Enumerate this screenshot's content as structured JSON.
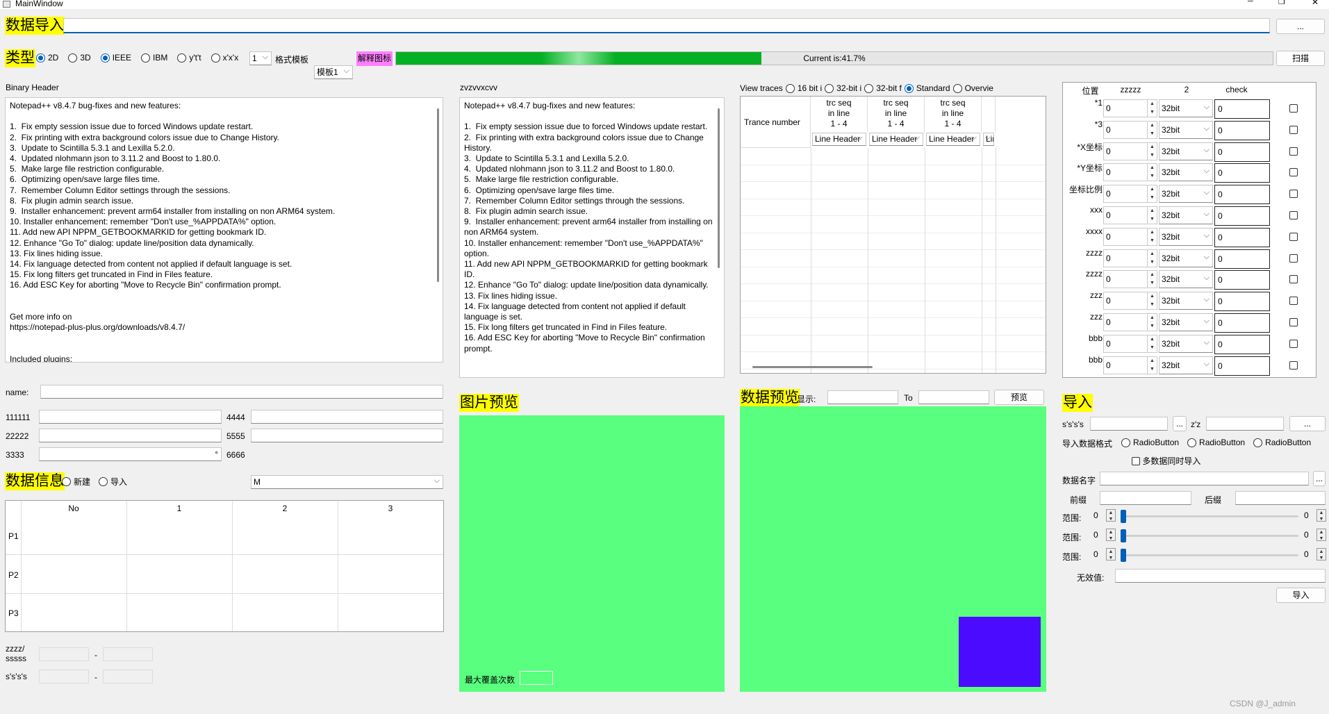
{
  "window": {
    "title": "MainWindow",
    "minimize": "─",
    "maximize": "❐",
    "close": "✕"
  },
  "import_bar": {
    "label": "数据导入",
    "path_value": "",
    "browse_label": "..."
  },
  "type_bar": {
    "label": "类型",
    "radios": [
      {
        "label": "2D",
        "checked": true
      },
      {
        "label": "3D",
        "checked": false
      },
      {
        "label": "IEEE",
        "checked": true
      },
      {
        "label": "IBM",
        "checked": false
      },
      {
        "label": "y't't",
        "checked": false
      },
      {
        "label": "x'x'x",
        "checked": false
      }
    ],
    "count_combo": "1",
    "template_label": "格式模板",
    "template_combo": "模板1",
    "explain_button": "解释图标",
    "progress_text": "Current is:41.7%",
    "progress": 0.417,
    "scan_button": "扫描",
    "colors": {
      "progress": "#06b025",
      "explain_bg": "#ff80ff"
    }
  },
  "binary_header": {
    "title": "Binary Header",
    "text": "Notepad++ v8.4.7 bug-fixes and new features:\n\n1.  Fix empty session issue due to forced Windows update restart.\n2.  Fix printing with extra background colors issue due to Change History.\n3.  Update to Scintilla 5.3.1 and Lexilla 5.2.0.\n4.  Updated nlohmann json to 3.11.2 and Boost to 1.80.0.\n5.  Make large file restriction configurable.\n6.  Optimizing open/save large files time.\n7.  Remember Column Editor settings through the sessions.\n8.  Fix plugin admin search issue.\n9.  Installer enhancement: prevent arm64 installer from installing on non ARM64 system.\n10. Installer enhancement: remember \"Don't use_%APPDATA%\" option.\n11. Add new API NPPM_GETBOOKMARKID for getting bookmark ID.\n12. Enhance \"Go To\" dialog: update line/position data dynamically.\n13. Fix lines hiding issue.\n14. Fix language detected from content not applied if default language is set.\n15. Fix long filters get truncated in Find in Files feature.\n16. Add ESC Key for aborting \"Move to Recycle Bin\" confirmation prompt.\n\n\nGet more info on\nhttps://notepad-plus-plus.org/downloads/v8.4.7/\n\n\nIncluded plugins:"
  },
  "second_panel": {
    "title": "zvzvvxcvv",
    "text": "Notepad++ v8.4.7 bug-fixes and new features:\n\n1.  Fix empty session issue due to forced Windows update restart.\n2.  Fix printing with extra background colors issue due to Change History.\n3.  Update to Scintilla 5.3.1 and Lexilla 5.2.0.\n4.  Updated nlohmann json to 3.11.2 and Boost to 1.80.0.\n5.  Make large file restriction configurable.\n6.  Optimizing open/save large files time.\n7.  Remember Column Editor settings through the sessions.\n8.  Fix plugin admin search issue.\n9.  Installer enhancement: prevent arm64 installer from installing on non ARM64 system.\n10. Installer enhancement: remember \"Don't use_%APPDATA%\" option.\n11. Add new API NPPM_GETBOOKMARKID for getting bookmark ID.\n12. Enhance \"Go To\" dialog: update line/position data dynamically.\n13. Fix lines hiding issue.\n14. Fix language detected from content not applied if default language is set.\n15. Fix long filters get truncated in Find in Files feature.\n16. Add ESC Key for aborting \"Move to Recycle Bin\" confirmation prompt."
  },
  "traces": {
    "label": "View traces",
    "radios": [
      {
        "label": "16 bit i",
        "checked": false
      },
      {
        "label": "32-bit i",
        "checked": false
      },
      {
        "label": "32-bit f",
        "checked": false
      },
      {
        "label": "Standard",
        "checked": true
      },
      {
        "label": "Overvie",
        "checked": false
      }
    ],
    "row_header": "Trance number",
    "columns": [
      {
        "title": "trc seq\nin line\n1 - 4",
        "combo": "Line Header"
      },
      {
        "title": "trc seq\nin line\n1 - 4",
        "combo": "Line Header"
      },
      {
        "title": "trc seq\nin line\n1 - 4",
        "combo": "Line Header"
      },
      {
        "title": "",
        "combo": "Line"
      }
    ]
  },
  "params": {
    "headers": [
      "位置",
      "zzzzz",
      "2",
      "check"
    ],
    "rows": [
      {
        "label": "*1",
        "pos": "0",
        "bits": "32bit",
        "value": "0"
      },
      {
        "label": "*3",
        "pos": "0",
        "bits": "32bit",
        "value": "0"
      },
      {
        "label": "*X坐标",
        "pos": "0",
        "bits": "32bit",
        "value": "0"
      },
      {
        "label": "*Y坐标",
        "pos": "0",
        "bits": "32bit",
        "value": "0"
      },
      {
        "label": "坐标比例",
        "pos": "0",
        "bits": "32bit",
        "value": "0"
      },
      {
        "label": "xxx",
        "pos": "0",
        "bits": "32bit",
        "value": "0"
      },
      {
        "label": "xxxx",
        "pos": "0",
        "bits": "32bit",
        "value": "0"
      },
      {
        "label": "zzzz",
        "pos": "0",
        "bits": "32bit",
        "value": "0"
      },
      {
        "label": "zzzz",
        "pos": "0",
        "bits": "32bit",
        "value": "0"
      },
      {
        "label": "zzz",
        "pos": "0",
        "bits": "32bit",
        "value": "0"
      },
      {
        "label": "zzz",
        "pos": "0",
        "bits": "32bit",
        "value": "0"
      },
      {
        "label": "bbb",
        "pos": "0",
        "bits": "32bit",
        "value": "0"
      },
      {
        "label": "bbb",
        "pos": "0",
        "bits": "32bit",
        "value": "0"
      }
    ]
  },
  "form": {
    "name_label": "name:",
    "name_value": "",
    "f1_label": "111111",
    "f1_value": "",
    "f2_label": "22222",
    "f2_value": "",
    "f3_label": "3333",
    "f3_value": "",
    "f3_unit": "°",
    "f4_label": "4444",
    "f4_value": "",
    "f5_label": "5555",
    "f5_value": "",
    "f6_label": "6666",
    "f6_value": "M"
  },
  "data_info": {
    "label": "数据信息",
    "radios": [
      {
        "label": "新建",
        "checked": false
      },
      {
        "label": "导入",
        "checked": false
      }
    ],
    "columns": [
      "No",
      "1",
      "2",
      "3"
    ],
    "rows": [
      "P1",
      "P2",
      "P3"
    ]
  },
  "ranges": {
    "r1_label": "zzzz/\nsssss",
    "r1_from": "",
    "r1_sep": "-",
    "r1_to": "",
    "r2_label": "s's's's",
    "r2_from": "",
    "r2_sep": "-",
    "r2_to": ""
  },
  "image_preview": {
    "label": "图片预览",
    "overlay_label": "最大覆盖次数",
    "overlay_value": "",
    "bg": "#59ff7e"
  },
  "data_preview": {
    "label": "数据预览",
    "show_label": "显示:",
    "from_value": "",
    "to_label": "To",
    "to_value": "",
    "preview_button": "预览",
    "bg": "#59ff7e",
    "marker_color": "#4b0bff"
  },
  "import_panel": {
    "label": "导入",
    "s_label": "s's's's",
    "s_value": "",
    "s_browse": "...",
    "z_label": "z'z",
    "z_value": "",
    "z_browse": "...",
    "format_label": "导入数据格式",
    "format_radios": [
      {
        "label": "RadioButton"
      },
      {
        "label": "RadioButton"
      },
      {
        "label": "RadioButton"
      }
    ],
    "multi_label": "多数据同时导入",
    "name_label": "数据名字",
    "name_value": "",
    "name_browse": "...",
    "prefix_label": "前缀",
    "prefix_value": "",
    "suffix_label": "后缀",
    "suffix_value": "",
    "range_rows": [
      {
        "label": "范围:",
        "from": "0",
        "to": "0",
        "value": 0
      },
      {
        "label": "范围:",
        "from": "0",
        "to": "0",
        "value": 0
      },
      {
        "label": "范围:",
        "from": "0",
        "to": "0",
        "value": 0
      }
    ],
    "invalid_label": "无效值:",
    "invalid_value": "",
    "import_button": "导入"
  },
  "watermark": "CSDN @J_admin"
}
